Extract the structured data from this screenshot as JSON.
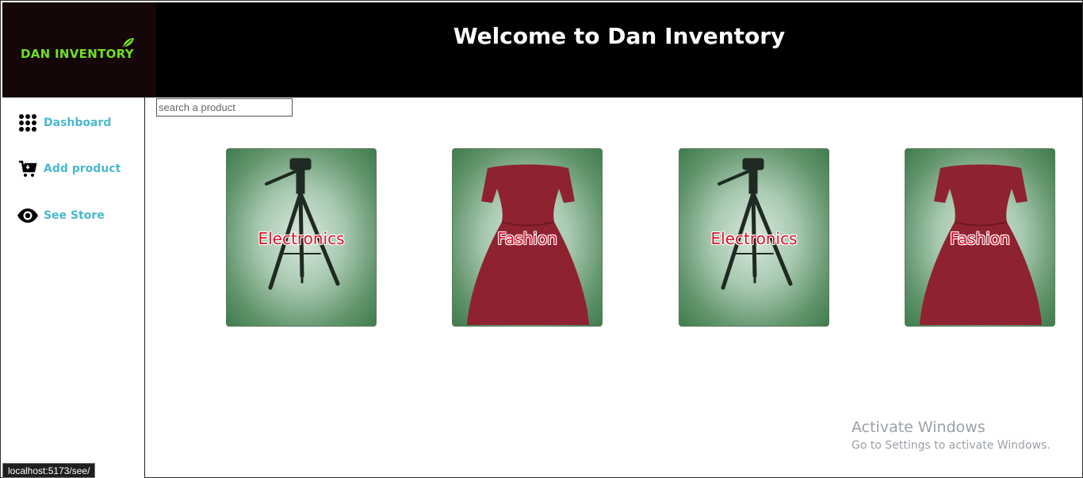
{
  "brand": {
    "name": "DAN INVENTORY",
    "leaf_icon": "leaf-icon",
    "accent": "#6fe01f"
  },
  "header": {
    "title": "Welcome to Dan Inventory"
  },
  "sidebar": {
    "items": [
      {
        "label": "Dashboard",
        "icon": "grid-dots-icon"
      },
      {
        "label": "Add product",
        "icon": "cart-icon"
      },
      {
        "label": "See Store",
        "icon": "eye-icon"
      }
    ],
    "label_color": "#4ab8cc"
  },
  "search": {
    "placeholder": "search a product",
    "value": ""
  },
  "products": [
    {
      "category": "Electronics",
      "image": "tripod"
    },
    {
      "category": "Fashion",
      "image": "dress"
    },
    {
      "category": "Electronics",
      "image": "tripod"
    },
    {
      "category": "Fashion",
      "image": "dress"
    }
  ],
  "watermark": {
    "title": "Activate Windows",
    "subtitle": "Go to Settings to activate Windows."
  },
  "status_bar": {
    "url": "localhost:5173/see/"
  }
}
